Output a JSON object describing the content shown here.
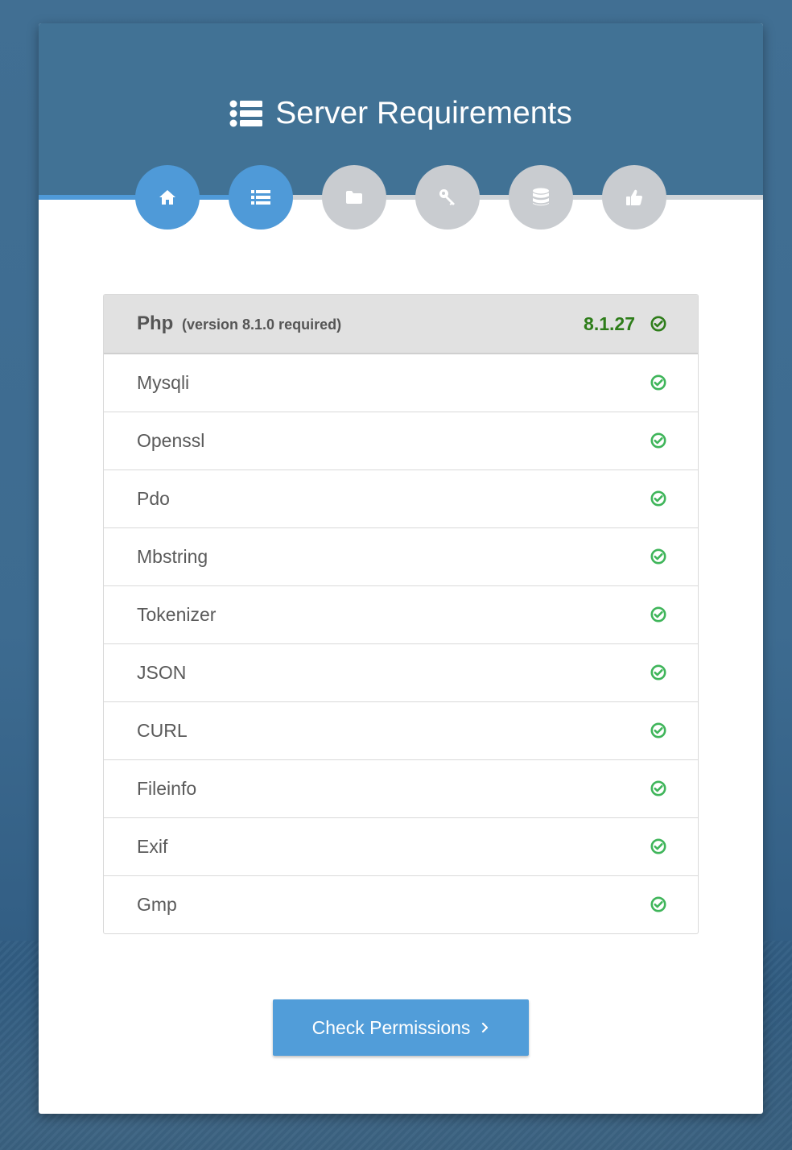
{
  "header": {
    "title": "Server Requirements",
    "title_icon": "list-icon",
    "color": "#417295"
  },
  "steps": [
    {
      "icon": "home-icon",
      "active": true
    },
    {
      "icon": "list-icon",
      "active": true
    },
    {
      "icon": "folder-icon",
      "active": false
    },
    {
      "icon": "key-icon",
      "active": false
    },
    {
      "icon": "database-icon",
      "active": false
    },
    {
      "icon": "thumbs-up-icon",
      "active": false
    }
  ],
  "requirements": {
    "php": {
      "name": "Php",
      "required": "(version 8.1.0 required)",
      "current": "8.1.27",
      "status": "ok"
    },
    "extensions": [
      {
        "name": "Mysqli",
        "status": "ok"
      },
      {
        "name": "Openssl",
        "status": "ok"
      },
      {
        "name": "Pdo",
        "status": "ok"
      },
      {
        "name": "Mbstring",
        "status": "ok"
      },
      {
        "name": "Tokenizer",
        "status": "ok"
      },
      {
        "name": "JSON",
        "status": "ok"
      },
      {
        "name": "CURL",
        "status": "ok"
      },
      {
        "name": "Fileinfo",
        "status": "ok"
      },
      {
        "name": "Exif",
        "status": "ok"
      },
      {
        "name": "Gmp",
        "status": "ok"
      }
    ]
  },
  "actions": {
    "next_label": "Check Permissions"
  },
  "colors": {
    "accent": "#4f9ad8",
    "success": "#3fb55a",
    "success_dark": "#2e7d1a",
    "inactive": "#c9ccd0"
  }
}
